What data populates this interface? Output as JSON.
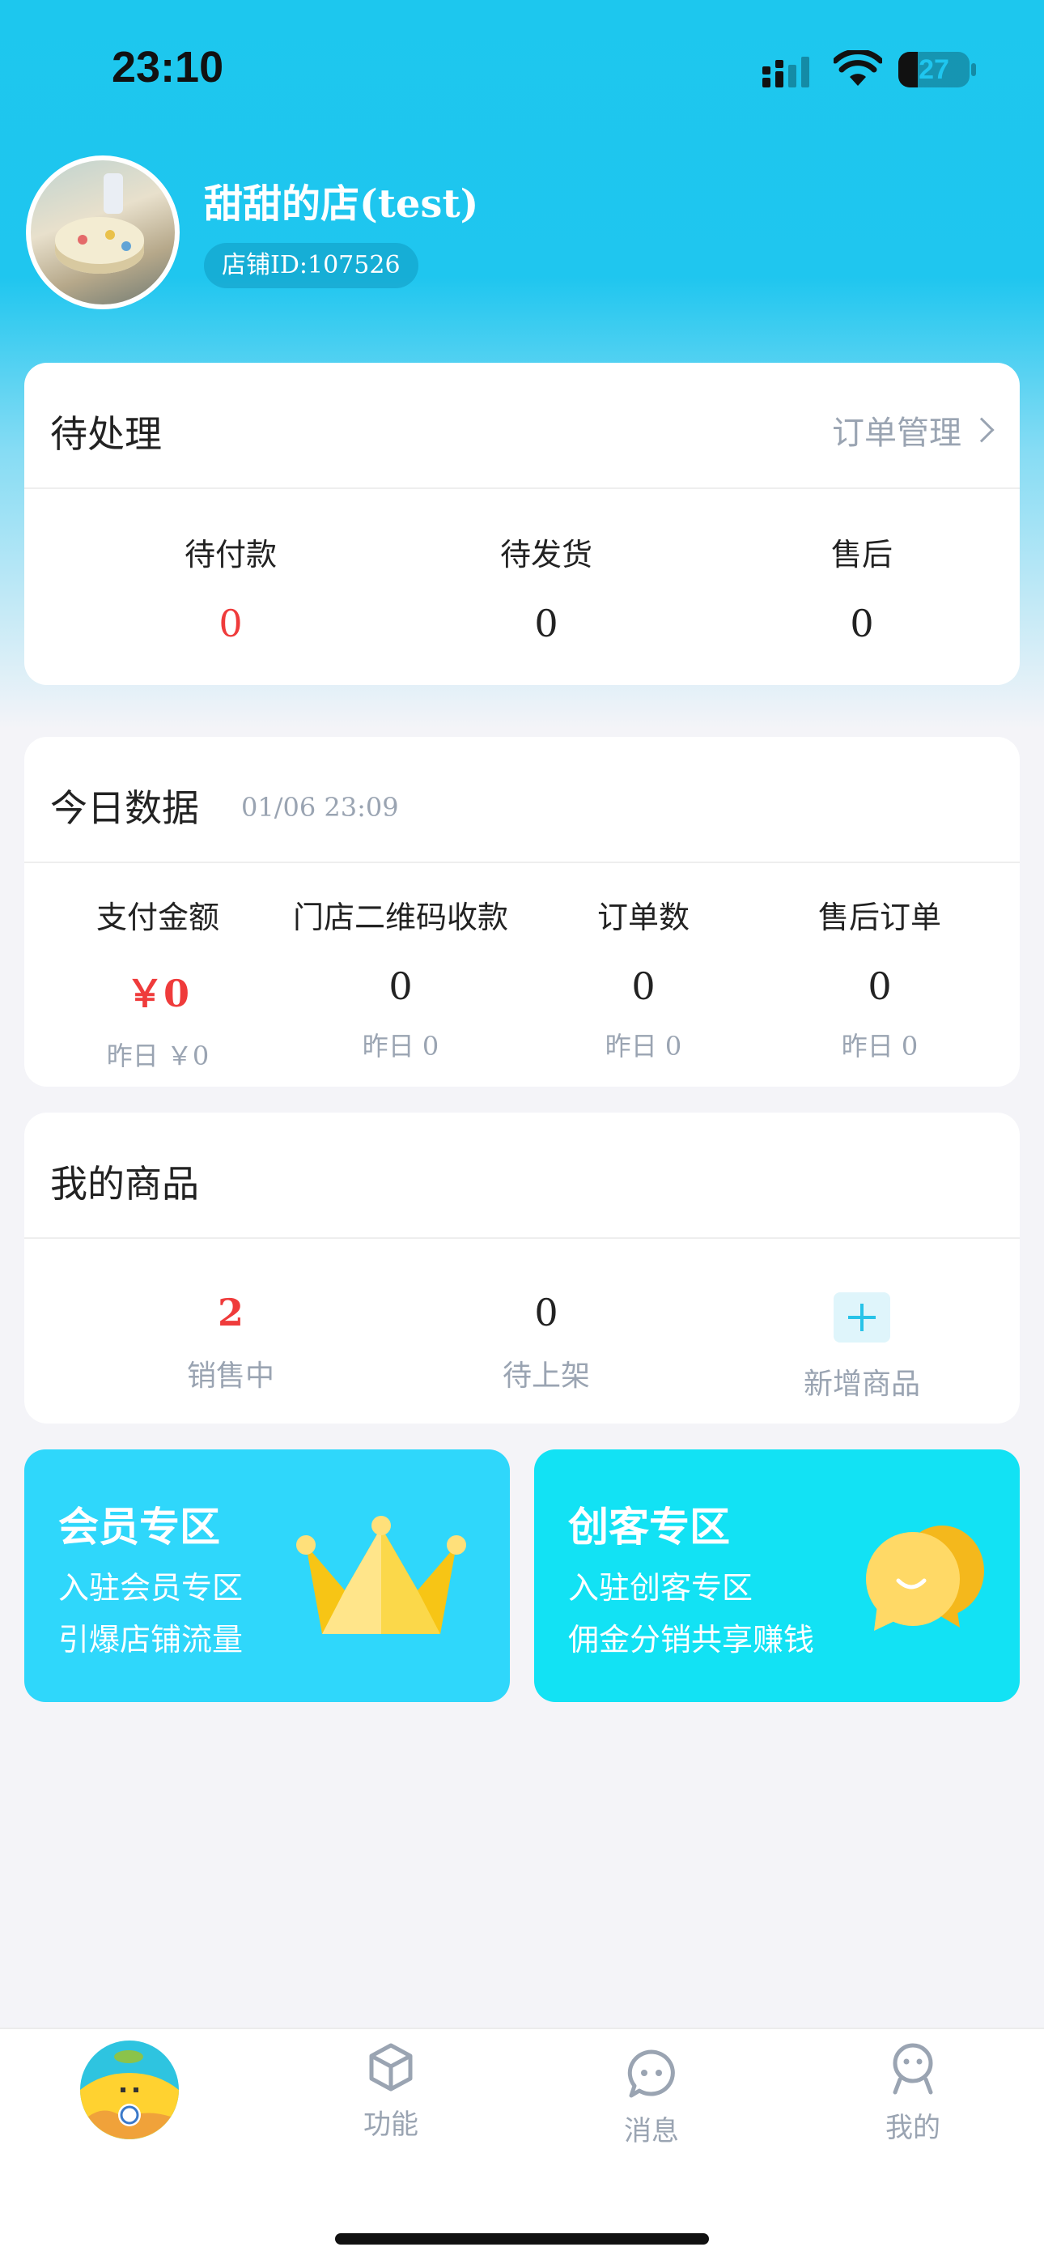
{
  "status_bar": {
    "time": "23:10",
    "battery": "27",
    "battery_level": 0.27
  },
  "store": {
    "name": "甜甜的店(test)",
    "id_label": "店铺ID:107526"
  },
  "pending": {
    "title": "待处理",
    "link": "订单管理",
    "items": [
      {
        "label": "待付款",
        "value": "0"
      },
      {
        "label": "待发货",
        "value": "0"
      },
      {
        "label": "售后",
        "value": "0"
      }
    ]
  },
  "today": {
    "title": "今日数据",
    "timestamp": "01/06 23:09",
    "items": [
      {
        "label": "支付金额",
        "value": "￥0",
        "yesterday_label": "昨日",
        "yesterday_value": "￥0"
      },
      {
        "label": "门店二维码收款",
        "value": "0",
        "yesterday_label": "昨日",
        "yesterday_value": "0"
      },
      {
        "label": "订单数",
        "value": "0",
        "yesterday_label": "昨日",
        "yesterday_value": "0"
      },
      {
        "label": "售后订单",
        "value": "0",
        "yesterday_label": "昨日",
        "yesterday_value": "0"
      }
    ]
  },
  "products": {
    "title": "我的商品",
    "on_sale": {
      "value": "2",
      "label": "销售中"
    },
    "pending": {
      "value": "0",
      "label": "待上架"
    },
    "add": {
      "label": "新增商品"
    }
  },
  "promos": {
    "member": {
      "title": "会员专区",
      "line1": "入驻会员专区",
      "line2": "引爆店铺流量",
      "icon": "crown-icon",
      "color": "#2fd7fb"
    },
    "creator": {
      "title": "创客专区",
      "line1": "入驻创客专区",
      "line2": "佣金分销共享赚钱",
      "icon": "chat-bubbles-icon",
      "color": "#12e2f4"
    }
  },
  "tabbar": {
    "home_icon": "mascot-avatar-icon",
    "items": [
      {
        "label": "功能",
        "icon": "cube-icon"
      },
      {
        "label": "消息",
        "icon": "message-icon"
      },
      {
        "label": "我的",
        "icon": "profile-icon"
      }
    ]
  },
  "colors": {
    "primary": "#1dc7ee",
    "accent_red": "#ef3b3b",
    "muted": "#9aa4b2"
  }
}
